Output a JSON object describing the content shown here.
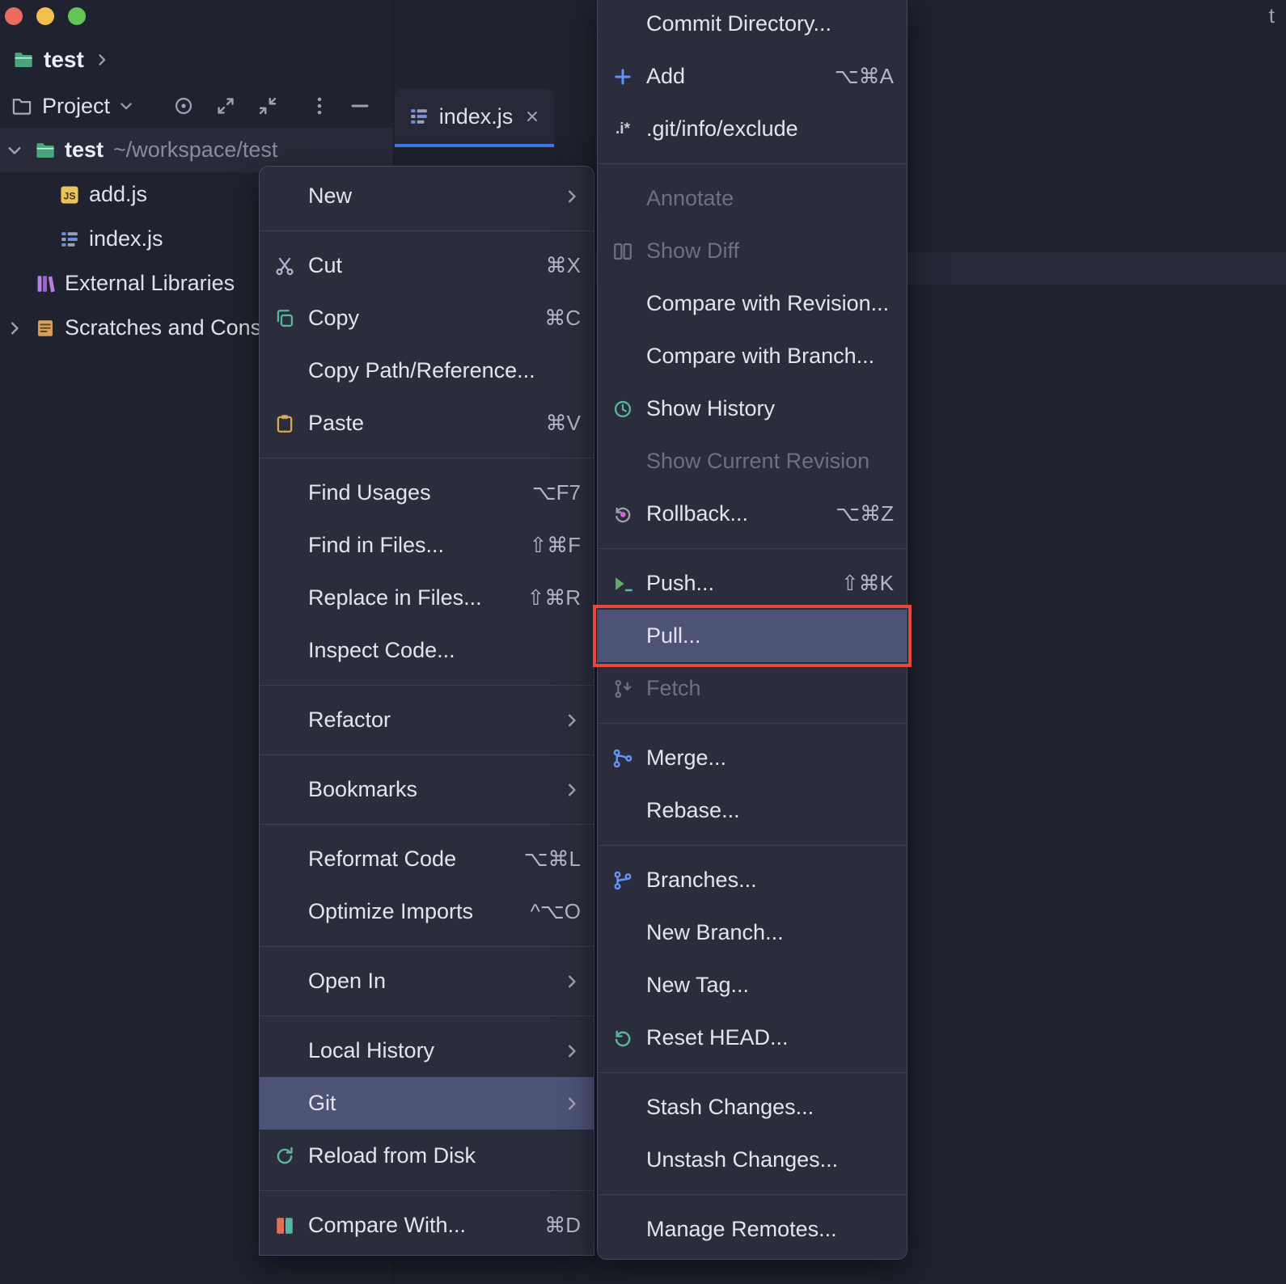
{
  "window": {
    "controls": [
      "close",
      "minimize",
      "zoom"
    ],
    "stray_text": "t"
  },
  "breadcrumb": {
    "project_label": "test"
  },
  "project_panel": {
    "title": "Project",
    "tree": [
      {
        "label": "test",
        "path": "~/workspace/test",
        "icon": "project-folder-icon",
        "chevron": "down",
        "indent": 0,
        "bold": true,
        "selected": true
      },
      {
        "label": "add.js",
        "icon": "js-file-icon",
        "chevron": "none",
        "indent": 1
      },
      {
        "label": "index.js",
        "icon": "indexjs-file-icon",
        "chevron": "none",
        "indent": 1
      },
      {
        "label": "External Libraries",
        "icon": "libraries-icon",
        "chevron": "none",
        "indent": 0
      },
      {
        "label": "Scratches and Consoles",
        "icon": "scratches-icon",
        "chevron": "right",
        "indent": 0
      }
    ]
  },
  "editor": {
    "tabs": [
      {
        "label": "index.js",
        "active": true
      }
    ]
  },
  "context_menu": {
    "items": [
      {
        "type": "item",
        "label": "New",
        "submenu": true
      },
      {
        "type": "separator"
      },
      {
        "type": "item",
        "label": "Cut",
        "icon": "cut-icon",
        "shortcut": "⌘X"
      },
      {
        "type": "item",
        "label": "Copy",
        "icon": "copy-icon",
        "shortcut": "⌘C"
      },
      {
        "type": "item",
        "label": "Copy Path/Reference..."
      },
      {
        "type": "item",
        "label": "Paste",
        "icon": "paste-icon",
        "shortcut": "⌘V"
      },
      {
        "type": "separator"
      },
      {
        "type": "item",
        "label": "Find Usages",
        "shortcut": "⌥F7"
      },
      {
        "type": "item",
        "label": "Find in Files...",
        "shortcut": "⇧⌘F"
      },
      {
        "type": "item",
        "label": "Replace in Files...",
        "shortcut": "⇧⌘R"
      },
      {
        "type": "item",
        "label": "Inspect Code..."
      },
      {
        "type": "separator"
      },
      {
        "type": "item",
        "label": "Refactor",
        "submenu": true
      },
      {
        "type": "separator"
      },
      {
        "type": "item",
        "label": "Bookmarks",
        "submenu": true
      },
      {
        "type": "separator"
      },
      {
        "type": "item",
        "label": "Reformat Code",
        "shortcut": "⌥⌘L"
      },
      {
        "type": "item",
        "label": "Optimize Imports",
        "shortcut": "^⌥O"
      },
      {
        "type": "separator"
      },
      {
        "type": "item",
        "label": "Open In",
        "submenu": true
      },
      {
        "type": "separator"
      },
      {
        "type": "item",
        "label": "Local History",
        "submenu": true
      },
      {
        "type": "item",
        "label": "Git",
        "submenu": true,
        "state": "selected"
      },
      {
        "type": "item",
        "label": "Reload from Disk",
        "icon": "refresh-icon"
      },
      {
        "type": "separator"
      },
      {
        "type": "item",
        "label": "Compare With...",
        "icon": "diff-icon",
        "shortcut": "⌘D"
      }
    ]
  },
  "git_submenu": {
    "items": [
      {
        "type": "item",
        "label": "Commit Directory..."
      },
      {
        "type": "item",
        "label": "Add",
        "icon": "add-icon",
        "shortcut": "⌥⌘A"
      },
      {
        "type": "item",
        "label": ".git/info/exclude",
        "icon": "exclude-file-icon"
      },
      {
        "type": "separator"
      },
      {
        "type": "item",
        "label": "Annotate",
        "state": "disabled"
      },
      {
        "type": "item",
        "label": "Show Diff",
        "icon": "show-diff-icon",
        "state": "disabled"
      },
      {
        "type": "item",
        "label": "Compare with Revision..."
      },
      {
        "type": "item",
        "label": "Compare with Branch..."
      },
      {
        "type": "item",
        "label": "Show History",
        "icon": "history-icon"
      },
      {
        "type": "item",
        "label": "Show Current Revision",
        "state": "disabled"
      },
      {
        "type": "item",
        "label": "Rollback...",
        "icon": "rollback-icon",
        "shortcut": "⌥⌘Z"
      },
      {
        "type": "separator"
      },
      {
        "type": "item",
        "label": "Push...",
        "icon": "push-icon",
        "shortcut": "⇧⌘K"
      },
      {
        "type": "item",
        "label": "Pull...",
        "state": "selected",
        "annotated": true
      },
      {
        "type": "item",
        "label": "Fetch",
        "icon": "fetch-icon",
        "state": "disabled"
      },
      {
        "type": "separator"
      },
      {
        "type": "item",
        "label": "Merge...",
        "icon": "merge-icon"
      },
      {
        "type": "item",
        "label": "Rebase..."
      },
      {
        "type": "separator"
      },
      {
        "type": "item",
        "label": "Branches...",
        "icon": "branches-icon"
      },
      {
        "type": "item",
        "label": "New Branch..."
      },
      {
        "type": "item",
        "label": "New Tag..."
      },
      {
        "type": "item",
        "label": "Reset HEAD...",
        "icon": "reset-icon"
      },
      {
        "type": "separator"
      },
      {
        "type": "item",
        "label": "Stash Changes..."
      },
      {
        "type": "item",
        "label": "Unstash Changes..."
      },
      {
        "type": "separator"
      },
      {
        "type": "item",
        "label": "Manage Remotes..."
      }
    ]
  },
  "annotation": {
    "highlighted_item": "Pull...",
    "style": "red-box",
    "color": "#e8473c"
  },
  "colors": {
    "selection_highlight": "#4d5377",
    "annotation_red": "#e8473c",
    "active_tab_underline": "#3d7ae0"
  }
}
